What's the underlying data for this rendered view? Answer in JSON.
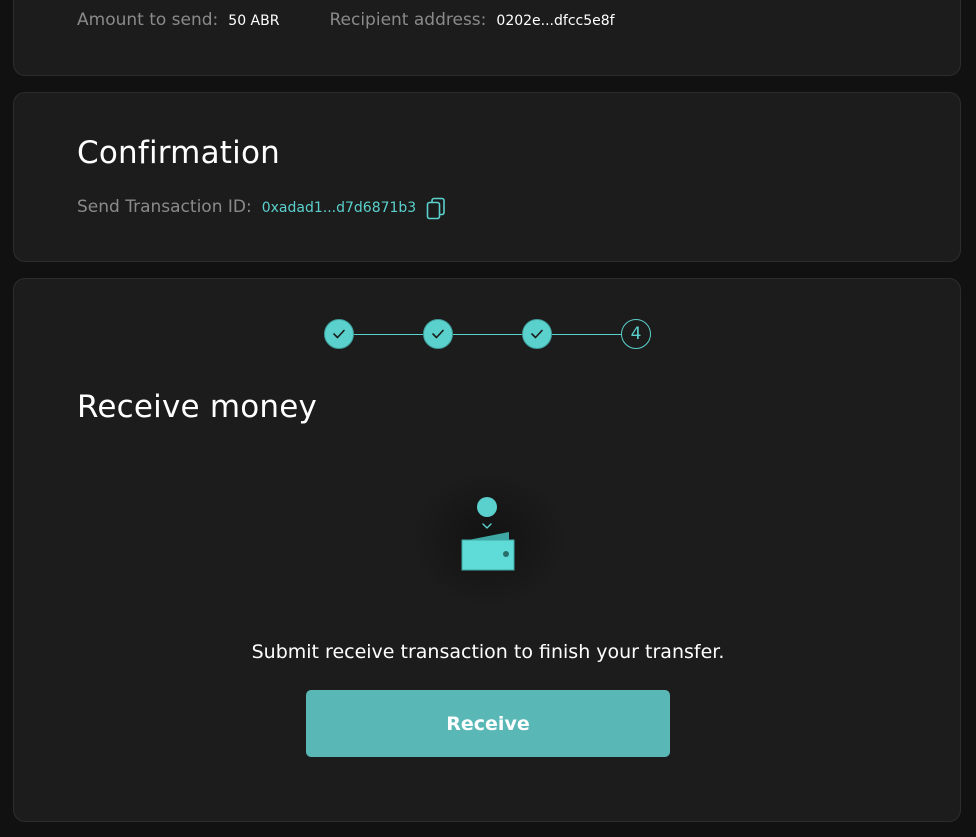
{
  "summary": {
    "amount_label": "Amount to send:",
    "amount_value": "50 ABR",
    "recipient_label": "Recipient address:",
    "recipient_value": "0202e...dfcc5e8f"
  },
  "confirmation": {
    "title": "Confirmation",
    "tx_label": "Send Transaction ID:",
    "tx_value": "0xadad1...d7d6871b3",
    "copy_icon": "copy-icon"
  },
  "receive": {
    "steps": [
      {
        "state": "done",
        "icon": "check-icon"
      },
      {
        "state": "done",
        "icon": "check-icon"
      },
      {
        "state": "done",
        "icon": "check-icon"
      },
      {
        "state": "current",
        "label": "4"
      }
    ],
    "title": "Receive money",
    "illustration_icon": "wallet-icon",
    "description": "Submit receive transaction to finish your transfer.",
    "button_label": "Receive"
  },
  "colors": {
    "background": "#111111",
    "card": "#1c1c1c",
    "accent": "#5ad1cc",
    "button": "#59b8b6",
    "muted_text": "#8a8a8a"
  }
}
